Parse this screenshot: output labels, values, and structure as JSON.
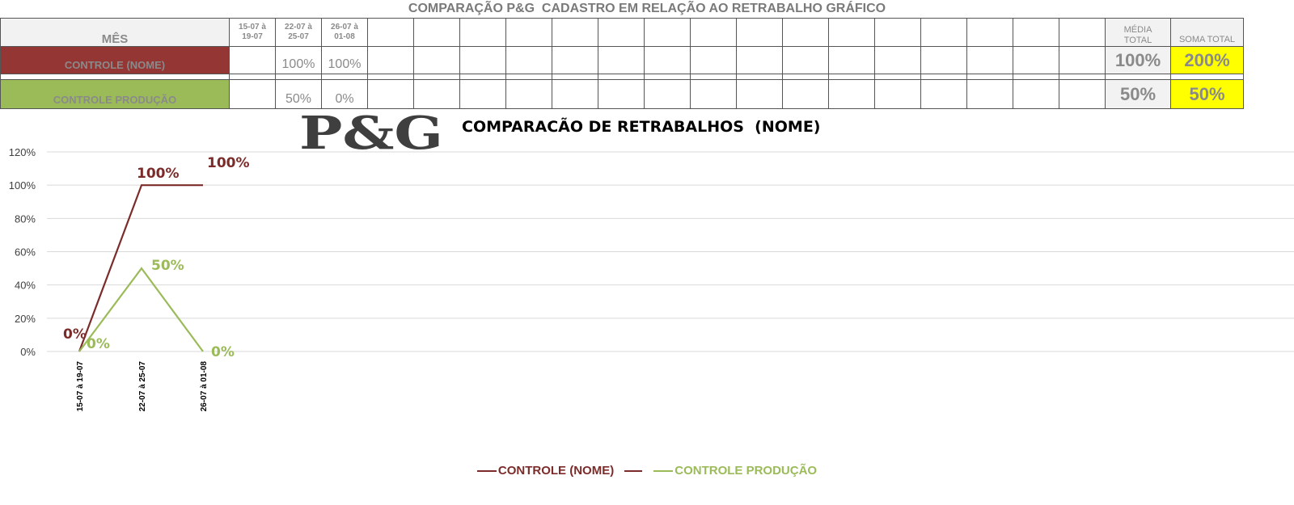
{
  "sheet": {
    "title": "COMPARAÇÃO P&G  CADASTRO EM RELAÇÃO AO RETRABALHO GRÁFICO",
    "mes_label": "MÊS",
    "date_headers": [
      "15-07 à\n19-07",
      "22-07 à\n25-07",
      "26-07 à\n01-08"
    ],
    "media_header": "MÉDIA\nTOTAL",
    "soma_header": "SOMA TOTAL",
    "rows": [
      {
        "label": "CONTROLE (NOME)",
        "values": [
          "",
          "100%",
          "100%"
        ],
        "media": "100%",
        "soma": "200%"
      },
      {
        "label": "CONTROLE PRODUÇÃO",
        "values": [
          "",
          "50%",
          "0%"
        ],
        "media": "50%",
        "soma": "50%"
      }
    ]
  },
  "logo_text": "P&G",
  "chart_data": {
    "type": "line",
    "title": "COMPARACÃO DE RETRABALHOS  (NOME)",
    "categories": [
      "15-07 à 19-07",
      "22-07 à 25-07",
      "26-07 à 01-08"
    ],
    "ylim": [
      0,
      120
    ],
    "yticks": [
      "0%",
      "20%",
      "40%",
      "60%",
      "80%",
      "100%",
      "120%"
    ],
    "grid": true,
    "legend_position": "bottom",
    "series": [
      {
        "name": "CONTROLE (NOME)",
        "color": "#7b2c2a",
        "values": [
          0,
          100,
          100
        ],
        "labels": [
          "0%",
          "100%",
          "100%"
        ]
      },
      {
        "name": "CONTROLE PRODUÇÃO",
        "color": "#9bbb59",
        "values": [
          0,
          50,
          0
        ],
        "labels": [
          "0%",
          "50%",
          "0%"
        ]
      }
    ]
  },
  "legend": {
    "item1": "CONTROLE (NOME)",
    "item2": "CONTROLE PRODUÇÃO"
  }
}
